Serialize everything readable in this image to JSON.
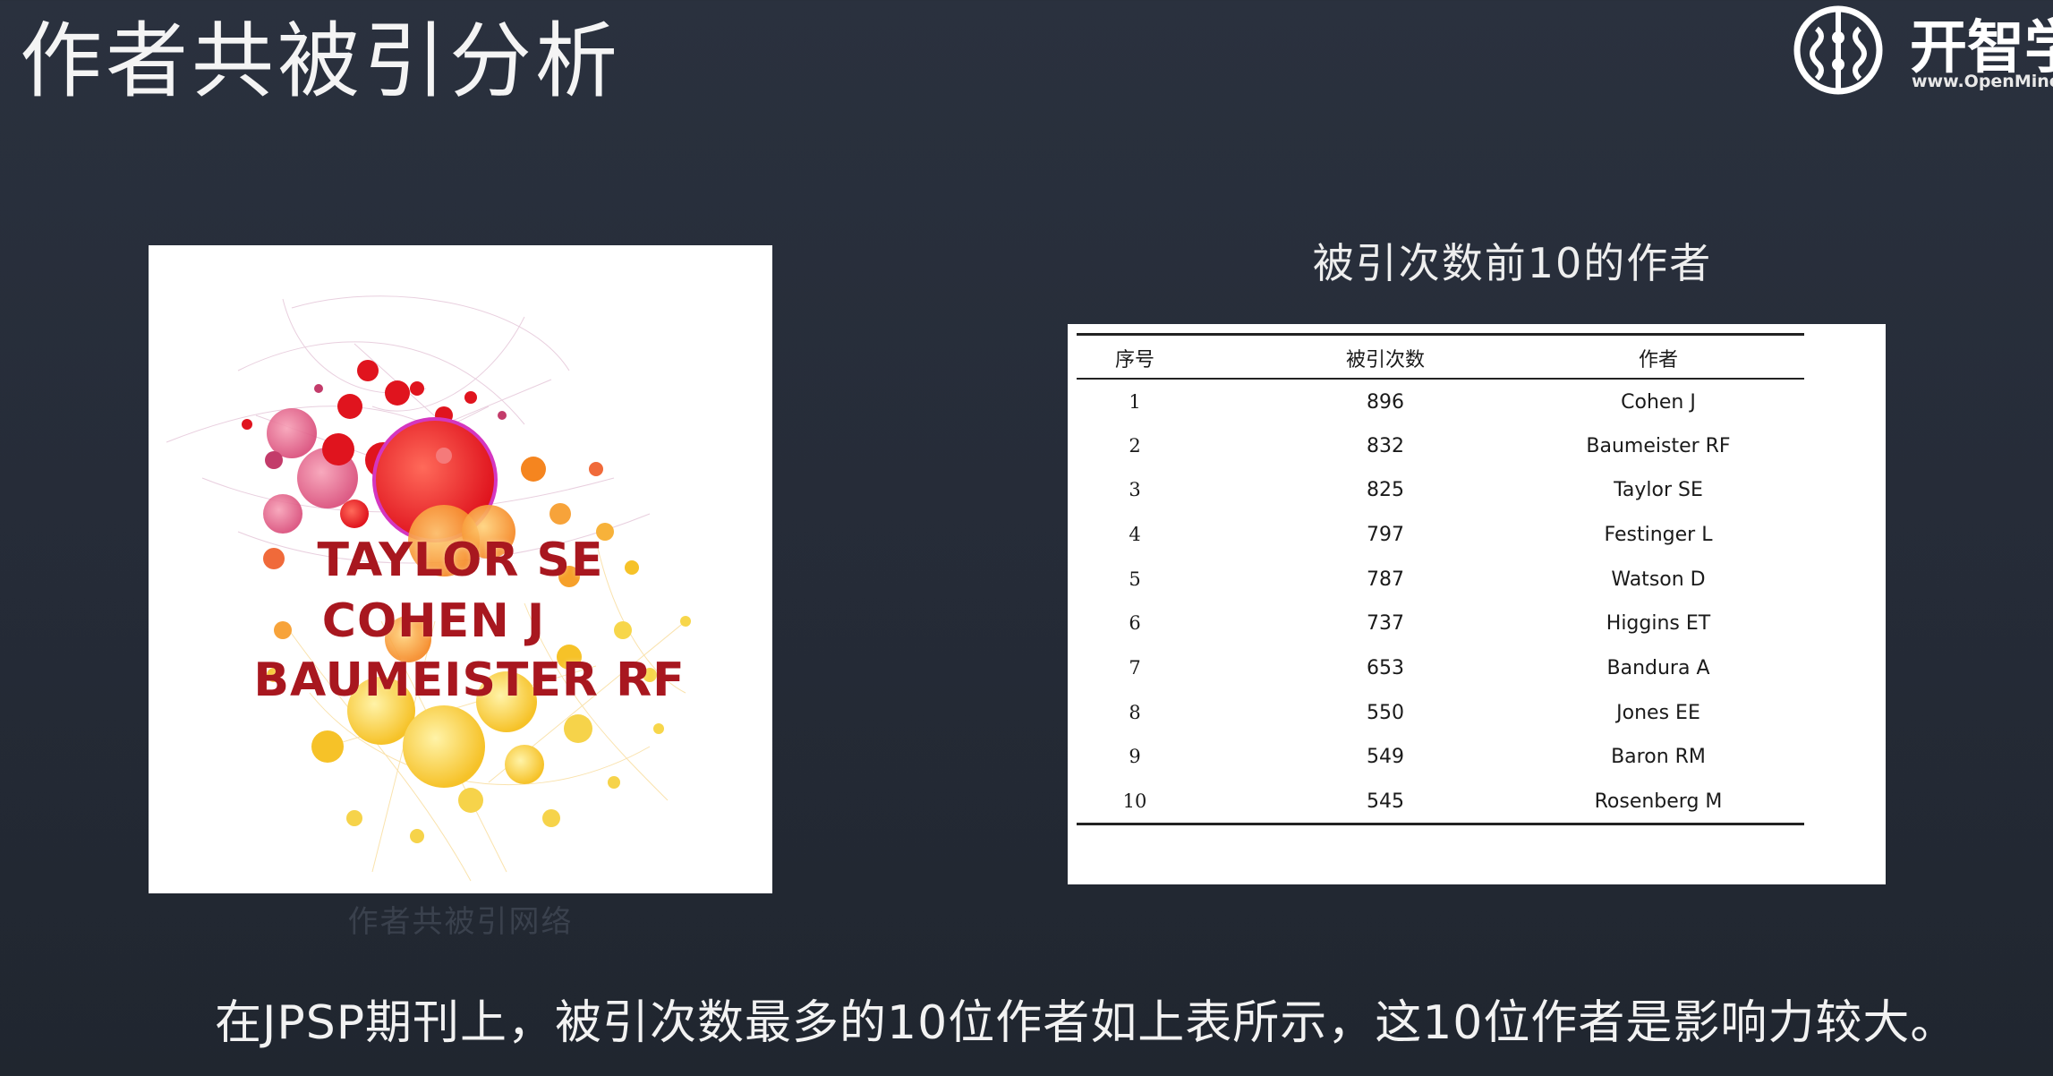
{
  "slide": {
    "title": "作者共被引分析",
    "caption": "在JPSP期刊上，被引次数最多的10位作者如上表所示，这10位作者是影响力较大。"
  },
  "logo": {
    "name": "开智学",
    "url": "www.OpenMinc",
    "icon": "brain-icon"
  },
  "network": {
    "labels": [
      "TAYLOR SE",
      "COHEN J",
      "BAUMEISTER RF"
    ],
    "caption": "作者共被引网络"
  },
  "table": {
    "title": "被引次数前10的作者",
    "headers": [
      "序号",
      "被引次数",
      "作者"
    ],
    "rows": [
      {
        "rank": "1",
        "count": "896",
        "author": "Cohen J"
      },
      {
        "rank": "2",
        "count": "832",
        "author": "Baumeister RF"
      },
      {
        "rank": "3",
        "count": "825",
        "author": "Taylor SE"
      },
      {
        "rank": "4",
        "count": "797",
        "author": "Festinger L"
      },
      {
        "rank": "5",
        "count": "787",
        "author": "Watson D"
      },
      {
        "rank": "6",
        "count": "737",
        "author": "Higgins ET"
      },
      {
        "rank": "7",
        "count": "653",
        "author": "Bandura A"
      },
      {
        "rank": "8",
        "count": "550",
        "author": "Jones EE"
      },
      {
        "rank": "9",
        "count": "549",
        "author": "Baron RM"
      },
      {
        "rank": "10",
        "count": "545",
        "author": "Rosenberg M"
      }
    ]
  }
}
